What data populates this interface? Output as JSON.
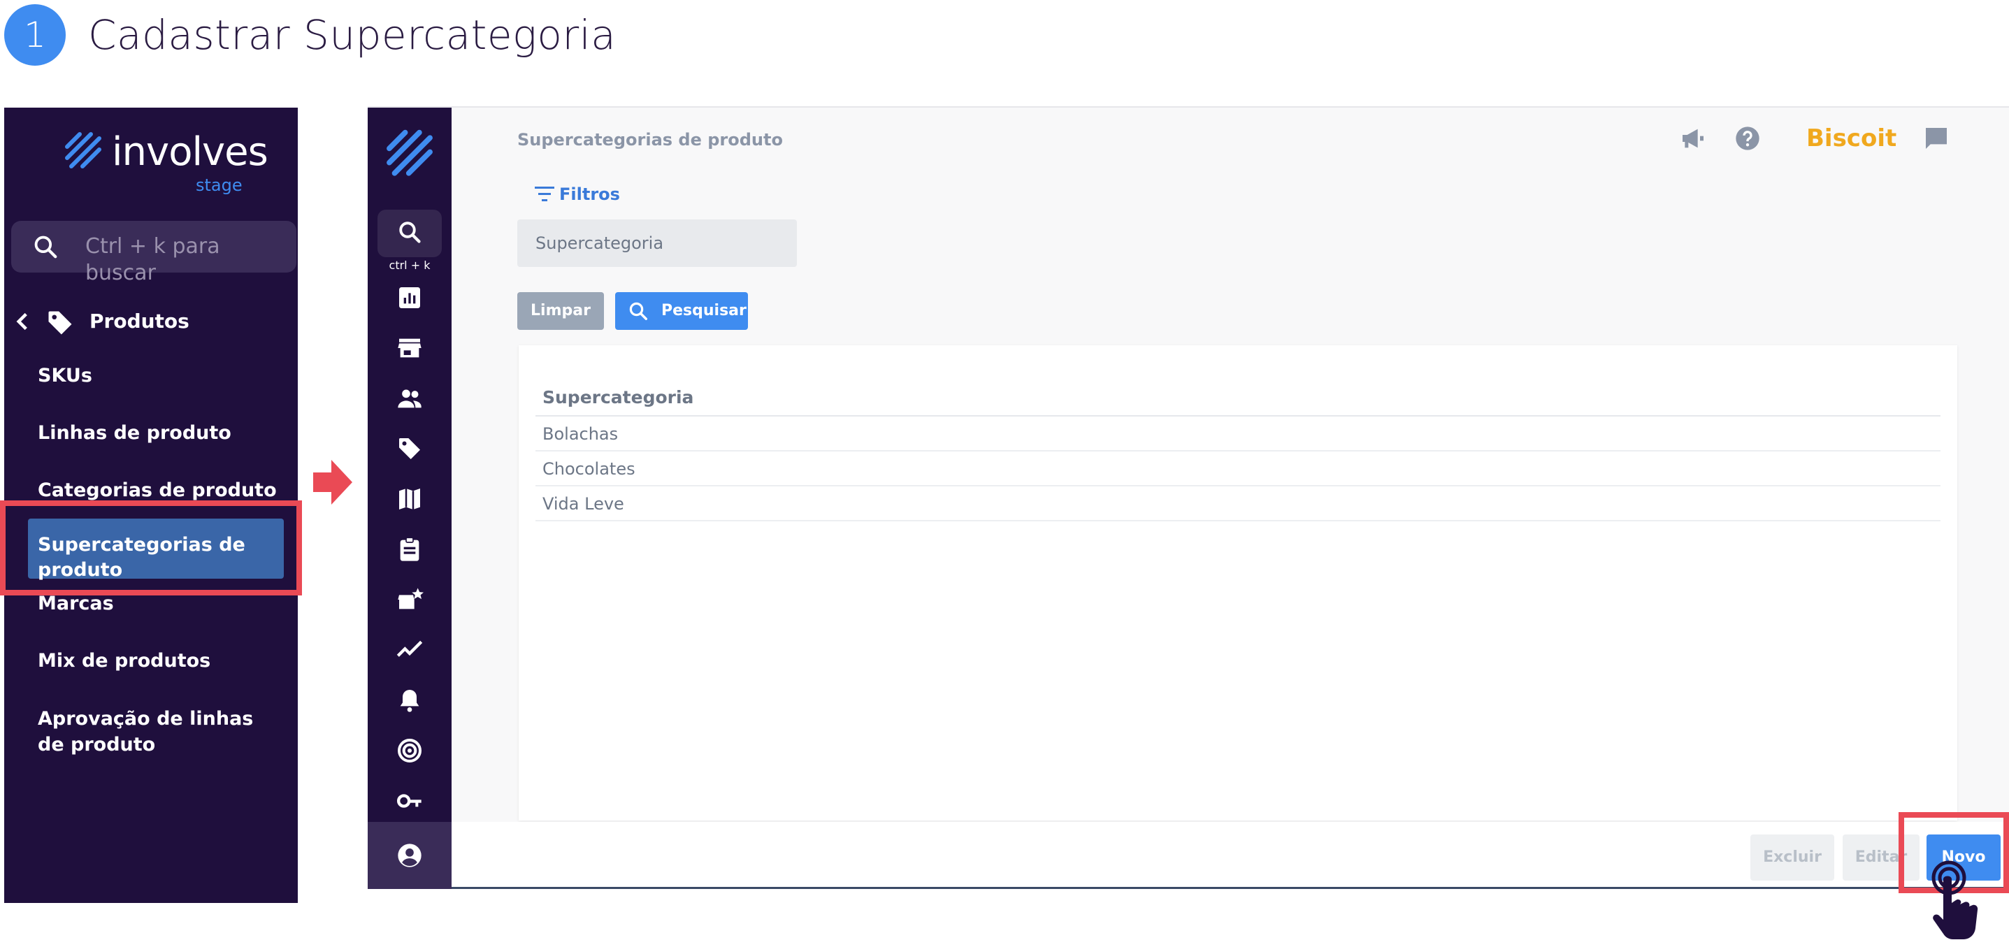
{
  "step": {
    "number": "1",
    "title": "Cadastrar Supercategoria"
  },
  "menu": {
    "logo_text": "involves",
    "logo_sub": "stage",
    "search_placeholder": "Ctrl + k para buscar",
    "section_label": "Produtos",
    "items": [
      {
        "label": "SKUs"
      },
      {
        "label": "Linhas de produto"
      },
      {
        "label": "Categorias de produto"
      },
      {
        "label": "Supercategorias de produto",
        "active": true
      },
      {
        "label": "Marcas"
      },
      {
        "label": "Mix de produtos"
      },
      {
        "label": "Aprovação de linhas de produto"
      }
    ]
  },
  "rail": {
    "search_shortcut": "ctrl + k",
    "icons": [
      "dashboard-icon",
      "store-icon",
      "people-icon",
      "tag-icon",
      "map-icon",
      "clipboard-icon",
      "store-star-icon",
      "trending-icon",
      "bell-icon",
      "radar-icon",
      "key-icon"
    ],
    "profile_icon": "account-circle-icon"
  },
  "app": {
    "breadcrumb": "Supercategorias de produto",
    "client_name": "Biscoit",
    "filters_label": "Filtros",
    "field_placeholder": "Supercategoria",
    "clear_label": "Limpar",
    "search_label": "Pesquisar",
    "table": {
      "header": "Supercategoria",
      "rows": [
        "Bolachas",
        "Chocolates",
        "Vida Leve"
      ]
    },
    "footer": {
      "delete_label": "Excluir",
      "edit_label": "Editar",
      "new_label": "Novo"
    }
  },
  "colors": {
    "menu_bg": "#1f0f3d",
    "accent": "#3f8cf0",
    "highlight": "#ea4a55",
    "brand_orange": "#f0a81e"
  }
}
